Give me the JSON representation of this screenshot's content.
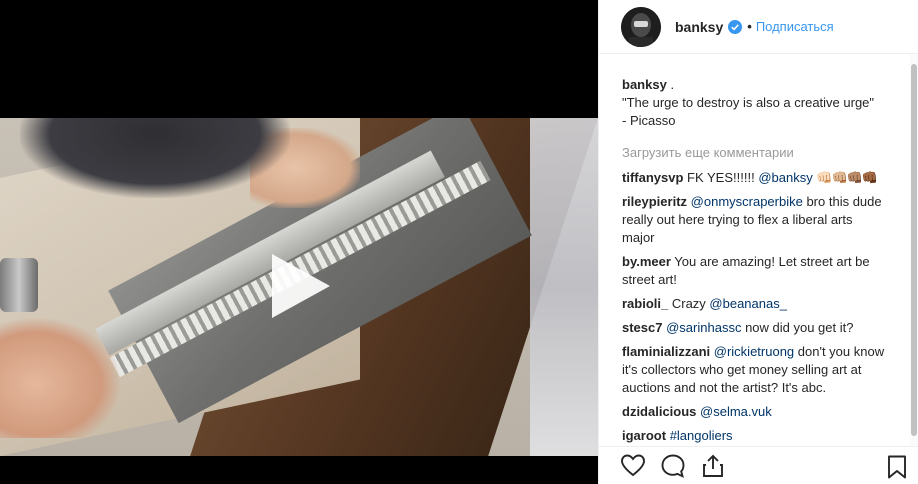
{
  "header": {
    "username": "banksy",
    "separator": "•",
    "follow_label": "Подписаться"
  },
  "caption": {
    "username": "banksy",
    "dot": ".",
    "line1": "\"The urge to destroy is also a creative urge\"",
    "line2": "- Picasso"
  },
  "load_more_label": "Загрузить еще комментарии",
  "comments": [
    {
      "user": "tiffanysvp",
      "pre": " FK YES!!!!!! ",
      "mention": "@banksy",
      "post": " ",
      "emoji": "👊🏻👊🏼👊🏽👊🏾"
    },
    {
      "user": "rileypieritz",
      "pre": " ",
      "mention": "@onmyscraperbike",
      "post": " bro this dude really out here trying to flex a liberal arts major"
    },
    {
      "user": "by.meer",
      "pre": " You are amazing! Let street art be street art!",
      "mention": "",
      "post": ""
    },
    {
      "user": "rabioli_",
      "pre": " Crazy ",
      "mention": "@beananas_",
      "post": ""
    },
    {
      "user": "stesc7",
      "pre": " ",
      "mention": "@sarinhassc",
      "post": " now did you get it?"
    },
    {
      "user": "flaminializzani",
      "pre": " ",
      "mention": "@rickietruong",
      "post": " don't you know it's collectors who get money selling art at auctions and not the artist? It's abc."
    },
    {
      "user": "dzidalicious",
      "pre": " ",
      "mention": "@selma.vuk",
      "post": ""
    },
    {
      "user": "igaroot",
      "pre": " ",
      "mention": "#langoliers",
      "post": ""
    }
  ],
  "icons": {
    "like": "heart-icon",
    "comment": "speech-bubble-icon",
    "share": "share-icon",
    "save": "bookmark-icon",
    "play": "play-icon",
    "verified": "verified-badge-icon"
  },
  "colors": {
    "link": "#3897f0",
    "mention": "#003569",
    "muted": "#999999",
    "text": "#262626"
  }
}
